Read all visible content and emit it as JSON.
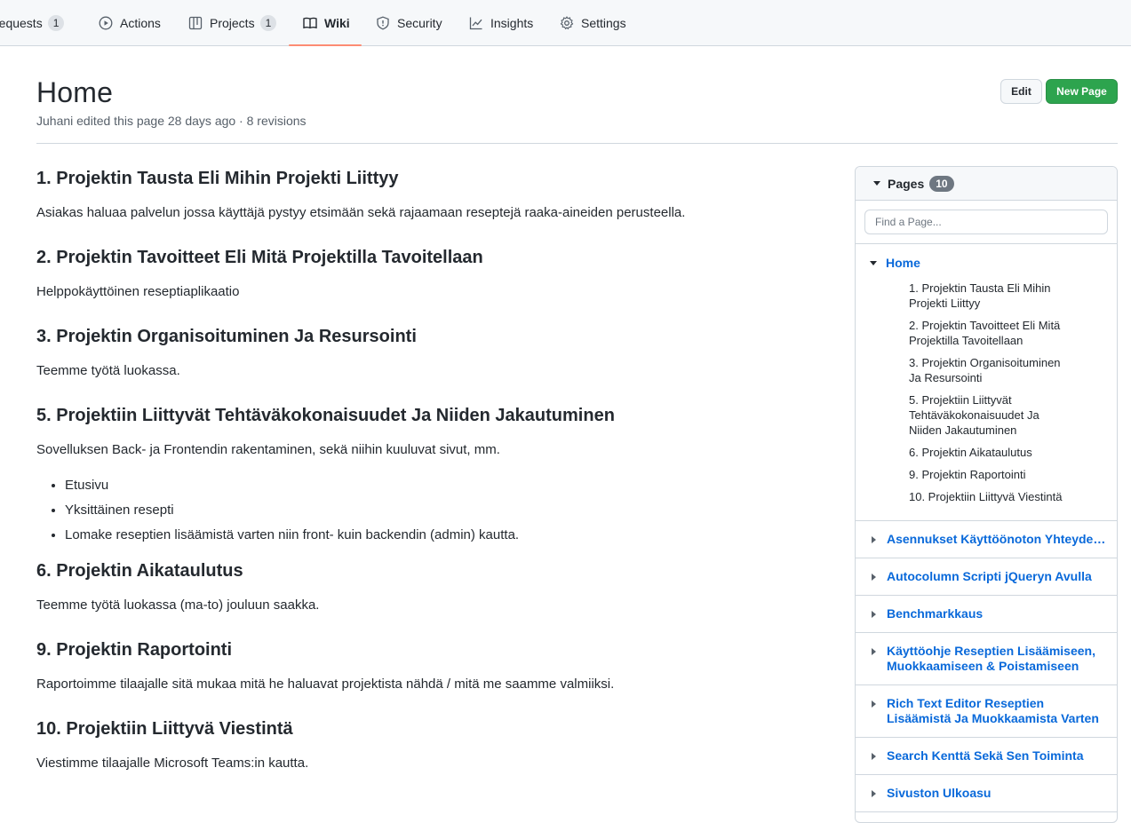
{
  "nav": {
    "tabs": [
      {
        "label": "requests",
        "count": "1",
        "icon": "pull-request-icon"
      },
      {
        "label": "Actions",
        "icon": "play-icon"
      },
      {
        "label": "Projects",
        "count": "1",
        "icon": "table-icon"
      },
      {
        "label": "Wiki",
        "icon": "book-icon",
        "selected": true
      },
      {
        "label": "Security",
        "icon": "shield-icon"
      },
      {
        "label": "Insights",
        "icon": "graph-icon"
      },
      {
        "label": "Settings",
        "icon": "gear-icon"
      }
    ],
    "accent_color": "#fd8c73"
  },
  "header": {
    "title": "Home",
    "meta": "Juhani edited this page 28 days ago · 8 revisions",
    "edit_label": "Edit",
    "new_page_label": "New Page",
    "new_page_color": "#2da44e"
  },
  "content": {
    "sections": [
      {
        "heading": "1. Projektin Tausta Eli Mihin Projekti Liittyy",
        "text": "Asiakas haluaa palvelun jossa käyttäjä pystyy etsimään sekä rajaamaan reseptejä raaka-aineiden perusteella."
      },
      {
        "heading": "2. Projektin Tavoitteet Eli Mitä Projektilla Tavoitellaan",
        "text": "Helppokäyttöinen reseptiaplikaatio"
      },
      {
        "heading": "3. Projektin Organisoituminen Ja Resursointi",
        "text": "Teemme työtä luokassa."
      },
      {
        "heading": "5. Projektiin Liittyvät Tehtäväkokonaisuudet Ja Niiden Jakautuminen",
        "text": "Sovelluksen Back- ja Frontendin rakentaminen, sekä niihin kuuluvat sivut, mm.",
        "bullets": [
          "Etusivu",
          "Yksittäinen resepti",
          "Lomake reseptien lisäämistä varten niin front- kuin backendin (admin) kautta."
        ]
      },
      {
        "heading": "6. Projektin Aikataulutus",
        "text": "Teemme työtä luokassa (ma-to) jouluun saakka."
      },
      {
        "heading": "9. Projektin Raportointi",
        "text": "Raportoimme tilaajalle sitä mukaa mitä he haluavat projektista nähdä / mitä me saamme valmiiksi."
      },
      {
        "heading": "10. Projektiin Liittyvä Viestintä",
        "text": "Viestimme tilaajalle Microsoft Teams:in kautta."
      }
    ]
  },
  "sidebar": {
    "title": "Pages",
    "count": "10",
    "search_placeholder": "Find a Page...",
    "home_label": "Home",
    "toc": [
      "1. Projektin Tausta Eli Mihin Projekti Liittyy",
      "2. Projektin Tavoitteet Eli Mitä Projektilla Tavoitellaan",
      "3. Projektin Organisoituminen Ja Resursointi",
      "5. Projektiin Liittyvät Tehtäväkokonaisuudet Ja Niiden Jakautuminen",
      "6. Projektin Aikataulutus",
      "9. Projektin Raportointi",
      "10. Projektiin Liittyvä Viestintä"
    ],
    "pages": [
      "Asennukset Käyttöönoton Yhteydessä...",
      "Autocolumn Scripti jQueryn Avulla",
      "Benchmarkkaus",
      "Käyttöohje Reseptien Lisäämiseen, Muokkaamiseen & Poistamiseen",
      "Rich Text Editor Reseptien Lisäämistä Ja Muokkaamista Varten",
      "Search Kenttä Sekä Sen Toiminta",
      "Sivuston Ulkoasu"
    ],
    "link_color": "#0969da"
  }
}
